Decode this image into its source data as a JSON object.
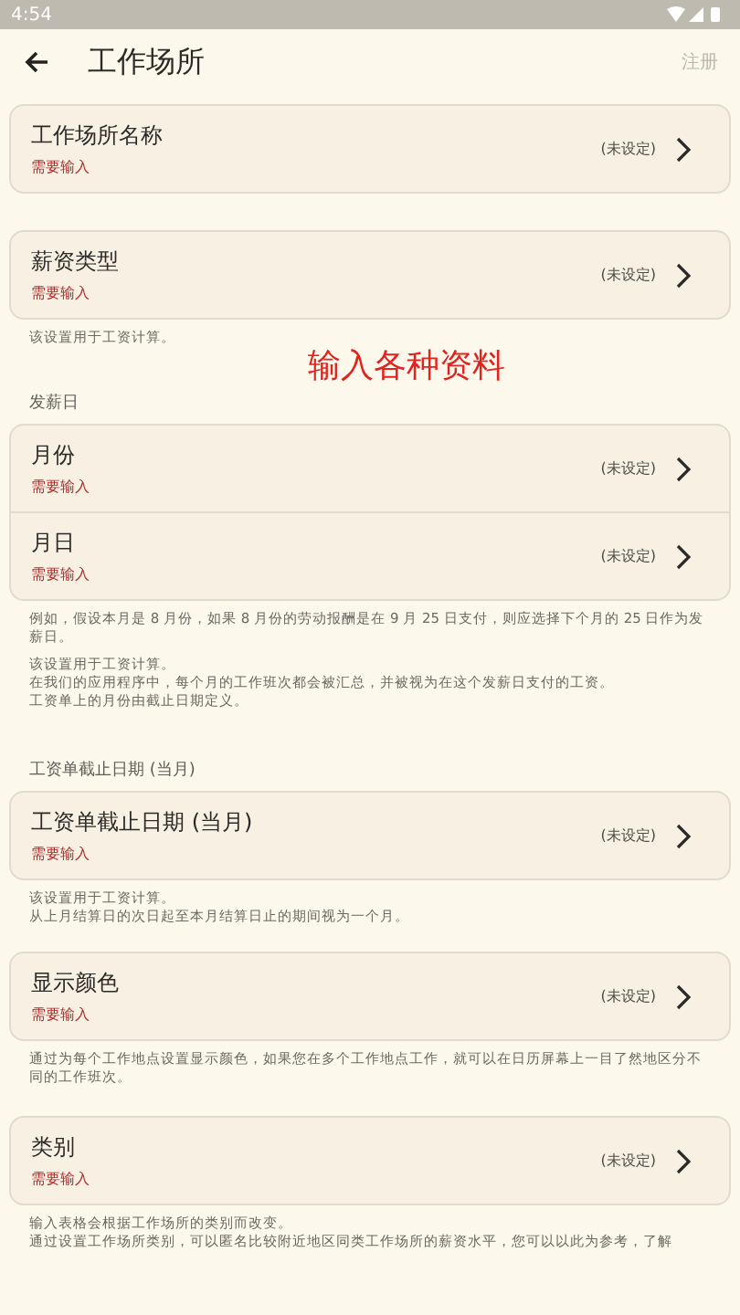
{
  "status_bar": {
    "time": "4:54"
  },
  "app_bar": {
    "title": "工作场所",
    "action": {
      "label": "注册",
      "disabled": true
    }
  },
  "caption": "输入各种资料",
  "sections": [
    {
      "rows": [
        {
          "title": "工作场所名称",
          "required": "需要输入",
          "value": "(未设定)"
        }
      ]
    },
    {
      "rows": [
        {
          "title": "薪资类型",
          "required": "需要输入",
          "value": "(未设定)"
        }
      ],
      "notes": [
        "该设置用于工资计算。"
      ]
    },
    {
      "label": "发薪日",
      "rows": [
        {
          "title": "月份",
          "required": "需要输入",
          "value": "(未设定)"
        },
        {
          "title": "月日",
          "required": "需要输入",
          "value": "(未设定)"
        }
      ],
      "notes": [
        "例如，假设本月是 8 月份，如果 8 月份的劳动报酬是在 9 月 25 日支付，则应选择下个月的 25 日作为发薪日。",
        [
          "该设置用于工资计算。",
          "在我们的应用程序中，每个月的工作班次都会被汇总，并被视为在这个发薪日支付的工资。",
          "工资单上的月份由截止日期定义。"
        ]
      ]
    },
    {
      "label": "工资单截止日期 (当月)",
      "rows": [
        {
          "title": "工资单截止日期 (当月)",
          "required": "需要输入",
          "value": "(未设定)"
        }
      ],
      "notes": [
        [
          "该设置用于工资计算。",
          "从上月结算日的次日起至本月结算日止的期间视为一个月。"
        ]
      ]
    },
    {
      "rows": [
        {
          "title": "显示颜色",
          "required": "需要输入",
          "value": "(未设定)"
        }
      ],
      "notes": [
        "通过为每个工作地点设置显示颜色，如果您在多个工作地点工作，就可以在日历屏幕上一目了然地区分不同的工作班次。"
      ]
    },
    {
      "rows": [
        {
          "title": "类别",
          "required": "需要输入",
          "value": "(未设定)"
        }
      ],
      "notes": [
        [
          "输入表格会根据工作场所的类别而改变。",
          "通过设置工作场所类别，可以匿名比较附近地区同类工作场所的薪资水平，您可以以此为参考，了解"
        ]
      ]
    }
  ]
}
